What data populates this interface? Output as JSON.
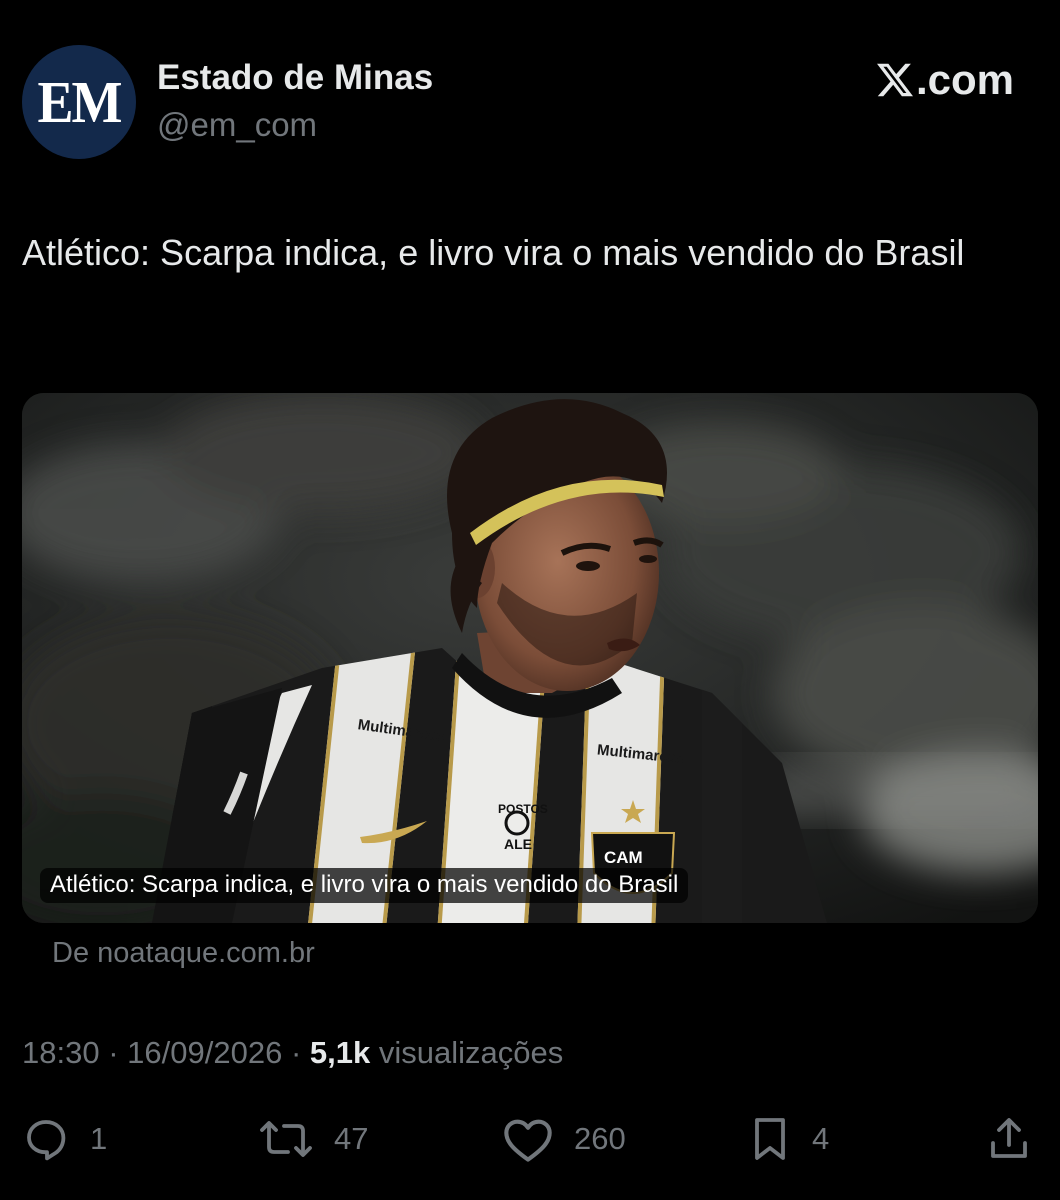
{
  "author": {
    "avatar_text": "EM",
    "display_name": "Estado de Minas",
    "handle": "@em_com"
  },
  "brand": {
    "label": ".com",
    "icon": "x-logo-icon"
  },
  "tweet": {
    "text": "Atlético: Scarpa indica, e livro vira o mais vendido do Brasil"
  },
  "media": {
    "caption": "Atlético: Scarpa indica, e livro vira o mais vendido do Brasil",
    "source": "De noataque.com.br",
    "jersey_text": {
      "sponsor_left": "Multimarcas",
      "sponsor_right": "Multimarcas",
      "postos_line1": "POSTOS",
      "postos_line2": "ALE",
      "crest": "CAM"
    }
  },
  "meta": {
    "time": "18:30",
    "separator": "·",
    "date": "16/09/2026",
    "views_count": "5,1k",
    "views_label": "visualizações"
  },
  "actions": {
    "reply_count": "1",
    "retweet_count": "47",
    "like_count": "260",
    "bookmark_count": "4"
  },
  "colors": {
    "background": "#000000",
    "text_primary": "#e7e9ea",
    "text_secondary": "#71767b",
    "avatar_bg": "#13294b"
  }
}
